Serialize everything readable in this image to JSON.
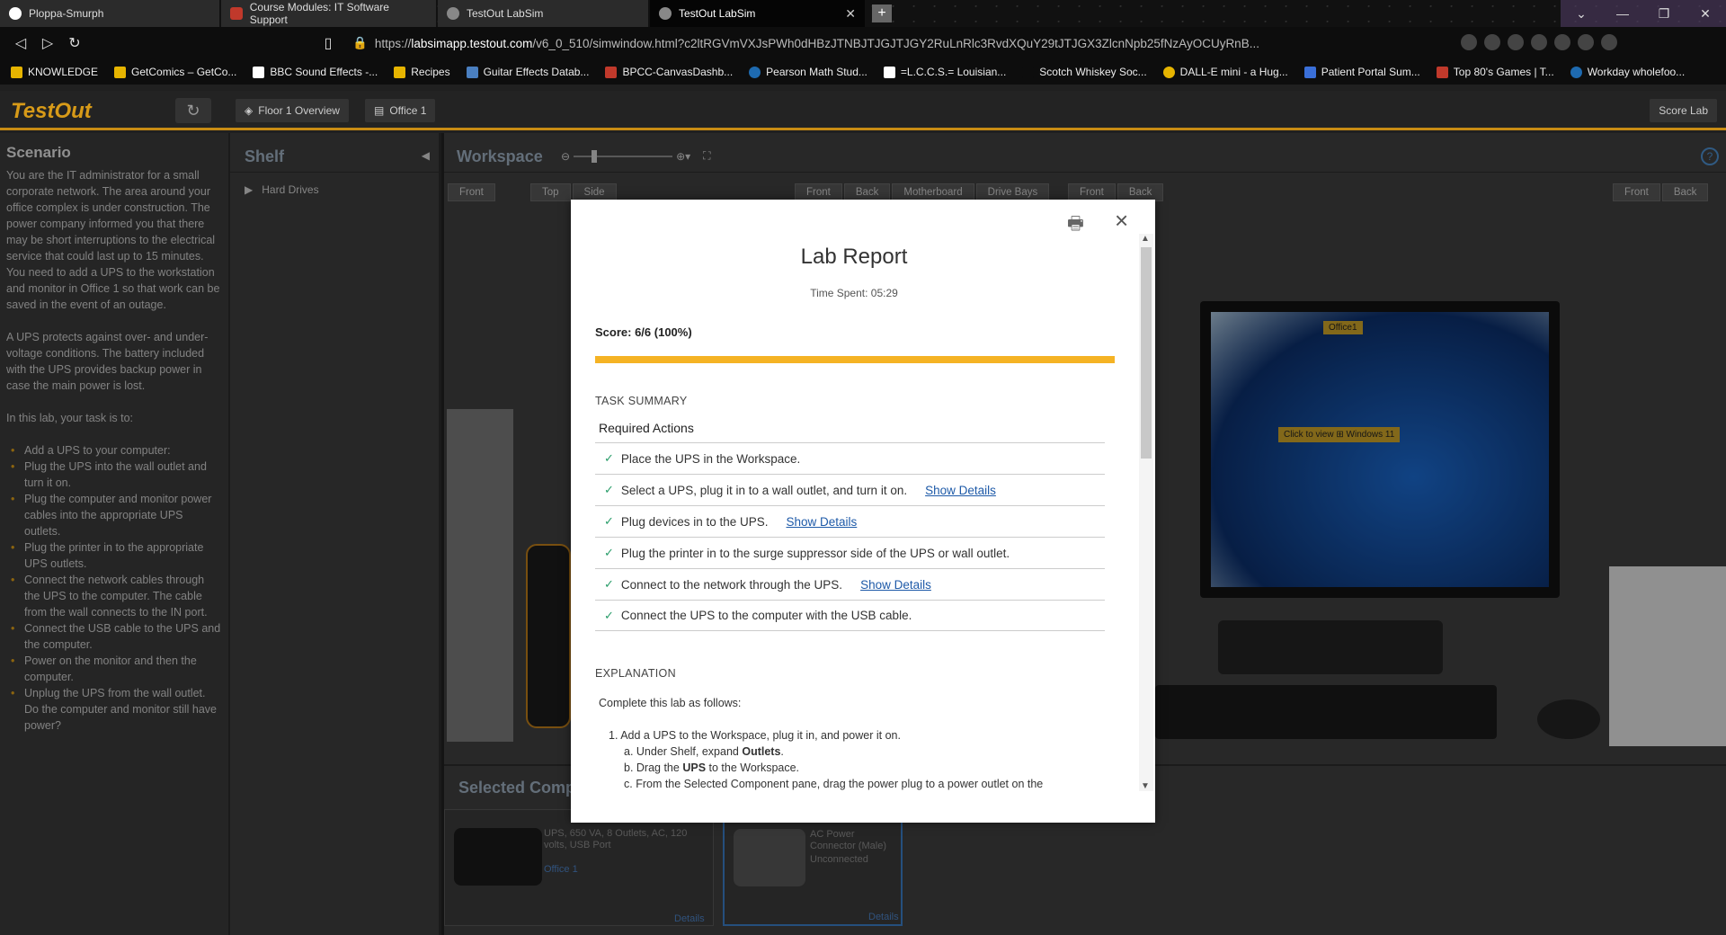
{
  "browser": {
    "tabs": [
      {
        "title": "Ploppa-Smurph",
        "icon": "github-icon",
        "color": "#ffffff"
      },
      {
        "title": "Course Modules: IT Software Support",
        "icon": "canvas-icon",
        "color": "#c0392b"
      },
      {
        "title": "TestOut LabSim",
        "icon": "testout-icon",
        "color": "#888888"
      },
      {
        "title": "TestOut LabSim",
        "icon": "testout-icon",
        "color": "#888888"
      }
    ],
    "url_prefix": "https://",
    "url_domain": "labsimapp.testout.com",
    "url_rest": "/v6_0_510/simwindow.html?c2ltRGVmVXJsPWh0dHBzJTNBJTJGJTJGY2RuLnRlc3RvdXQuY29tJTJGX3ZlcnNpb25fNzAyOCUyRnB...",
    "bookmarks": [
      "KNOWLEDGE",
      "GetComics – GetCo...",
      "BBC Sound Effects -...",
      "Recipes",
      "Guitar Effects Datab...",
      "BPCC-CanvasDashb...",
      "Pearson Math Stud...",
      "=L.C.C.S.= Louisian...",
      "Scotch Whiskey Soc...",
      "DALL-E mini - a Hug...",
      "Patient Portal Sum...",
      "Top 80's Games | T...",
      "Workday wholefoo..."
    ]
  },
  "app": {
    "logo": "TestOut",
    "floor_btn": "Floor 1 Overview",
    "office_btn": "Office 1",
    "score_btn": "Score Lab"
  },
  "scenario": {
    "title": "Scenario",
    "p1": "You are the IT administrator for a small corporate network. The area around your office complex is under construction. The power company informed you that there may be short interruptions to the electrical service that could last up to 15 minutes. You need to add a UPS to the workstation and monitor in Office 1 so that work can be saved in the event of an outage.",
    "p2": "A UPS protects against over- and under-voltage conditions. The battery included with the UPS provides backup power in case the main power is lost.",
    "p3": "In this lab, your task is to:",
    "items": [
      "Add a UPS to your computer:",
      "Plug the UPS into the wall outlet and turn it on.",
      "Plug the computer and monitor power cables into the appropriate UPS outlets.",
      "Plug the printer in to the appropriate UPS outlets.",
      "Connect the network cables through the UPS to the computer. The cable from the wall connects to the IN port.",
      "Connect the USB cable to the UPS and the computer.",
      "Power on the monitor and then the computer.",
      "Unplug the UPS from the wall outlet. Do the computer and monitor still have power?"
    ]
  },
  "shelf": {
    "title": "Shelf",
    "item": "Hard Drives"
  },
  "workspace": {
    "title": "Workspace",
    "views1": [
      "Front"
    ],
    "views2": [
      "Top",
      "Side"
    ],
    "views3": [
      "Front",
      "Back",
      "Motherboard",
      "Drive Bays"
    ],
    "views4": [
      "Front",
      "Back"
    ],
    "views5": [
      "Front",
      "Back"
    ],
    "monitor_tag": "Office1",
    "click_view": "Click to view",
    "os_label": "Windows 11"
  },
  "selected": {
    "title": "Selected Component",
    "ups_desc": "UPS, 650 VA, 8 Outlets, AC, 120 volts, USB Port",
    "ups_loc": "Office 1",
    "details": "Details",
    "plug_name": "AC Power Connector (Male)",
    "plug_status": "Unconnected"
  },
  "report": {
    "title": "Lab Report",
    "time_spent": "Time Spent: 05:29",
    "score": "Score: 6/6 (100%)",
    "score_fraction": 1.0,
    "task_summary": "TASK SUMMARY",
    "required": "Required Actions",
    "tasks": [
      {
        "text": "Place the UPS in the Workspace.",
        "details": ""
      },
      {
        "text": "Select a UPS, plug it in to a wall outlet, and turn it on.",
        "details": "Show Details"
      },
      {
        "text": "Plug devices in to the UPS.",
        "details": "Show Details"
      },
      {
        "text": "Plug the printer in to the surge suppressor side of the UPS or wall outlet.",
        "details": ""
      },
      {
        "text": "Connect to the network through the UPS.",
        "details": "Show Details"
      },
      {
        "text": "Connect the UPS to the computer with the USB cable.",
        "details": ""
      }
    ],
    "explanation": "EXPLANATION",
    "intro": "Complete this lab as follows:",
    "step1": "1. Add a UPS to the Workspace, plug it in, and power it on.",
    "a_pre": "a. Under Shelf, expand ",
    "a_bold": "Outlets",
    "b_pre": "b. Drag the ",
    "b_bold": "UPS",
    "b_post": " to the Workspace.",
    "c": "c. From the Selected Component pane, drag the power plug to a power outlet on the"
  }
}
